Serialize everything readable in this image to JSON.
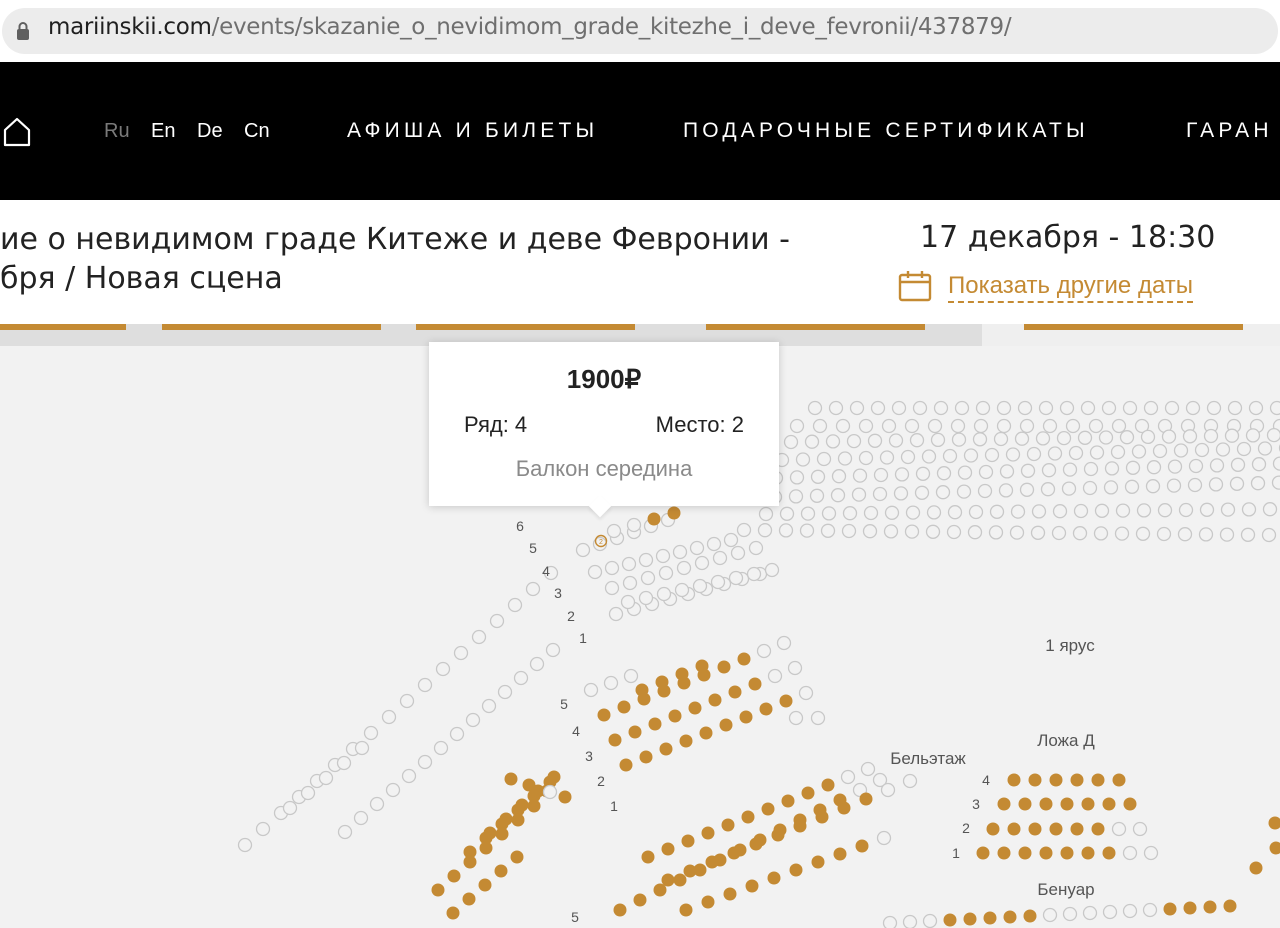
{
  "browser": {
    "url_host": "mariinskii.com",
    "url_path": "/events/skazanie_o_nevidimom_grade_kitezhe_i_deve_fevronii/437879/"
  },
  "nav": {
    "languages": [
      "Ru",
      "En",
      "De",
      "Cn"
    ],
    "links": [
      "АФИША И БИЛЕТЫ",
      "ПОДАРОЧНЫЕ СЕРТИФИКАТЫ",
      "ГАРАН"
    ]
  },
  "event": {
    "title_line1": "ие о невидимом граде Китеже и деве Февронии -",
    "title_line2": "бря   / Новая сцена",
    "datetime": "17 декабря - 18:30",
    "other_dates": "Показать другие даты"
  },
  "tooltip": {
    "price": "1900₽",
    "row": "Ряд: 4",
    "seat": "Место: 2",
    "section": "Балкон середина"
  },
  "map_labels": {
    "tier1": "1 ярус",
    "beletage": "Бельэтаж",
    "box_d": "Ложа Д",
    "benoir": "Бенуар",
    "balcony_rows": [
      "6",
      "5",
      "4",
      "3",
      "2",
      "1"
    ],
    "tier_rows": [
      "5",
      "4",
      "3",
      "2",
      "1"
    ],
    "box_rows": [
      "4",
      "3",
      "2",
      "1"
    ],
    "parterre_row": "5",
    "selected_seat": "2"
  },
  "colors": {
    "accent": "#c48a33",
    "seat_free_outline": "#c8c8c8",
    "nav_bg": "#000000"
  }
}
